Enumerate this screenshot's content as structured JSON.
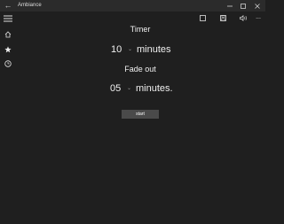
{
  "window": {
    "title": "Ambiance",
    "back_icon": "back-arrow-icon",
    "controls": [
      "minimize-icon",
      "maximize-icon",
      "close-icon"
    ]
  },
  "nav": {
    "menu_icon": "hamburger-menu-icon",
    "items": [
      {
        "icon": "home-icon"
      },
      {
        "icon": "star-icon"
      },
      {
        "icon": "clock-icon"
      }
    ]
  },
  "toolbar": {
    "icons": [
      "stop-icon",
      "save-icon",
      "volume-icon",
      "more-icon"
    ],
    "more_label": "..."
  },
  "timer": {
    "heading": "Timer",
    "value": "10",
    "unit": "minutes"
  },
  "fadeout": {
    "heading": "Fade out",
    "value": "05",
    "unit": "minutes."
  },
  "start_label": "start",
  "colors": {
    "background": "#1f1f1f",
    "titlebar": "#2b2b2b",
    "button": "#4a4a4a",
    "text": "#f0f0f0"
  }
}
